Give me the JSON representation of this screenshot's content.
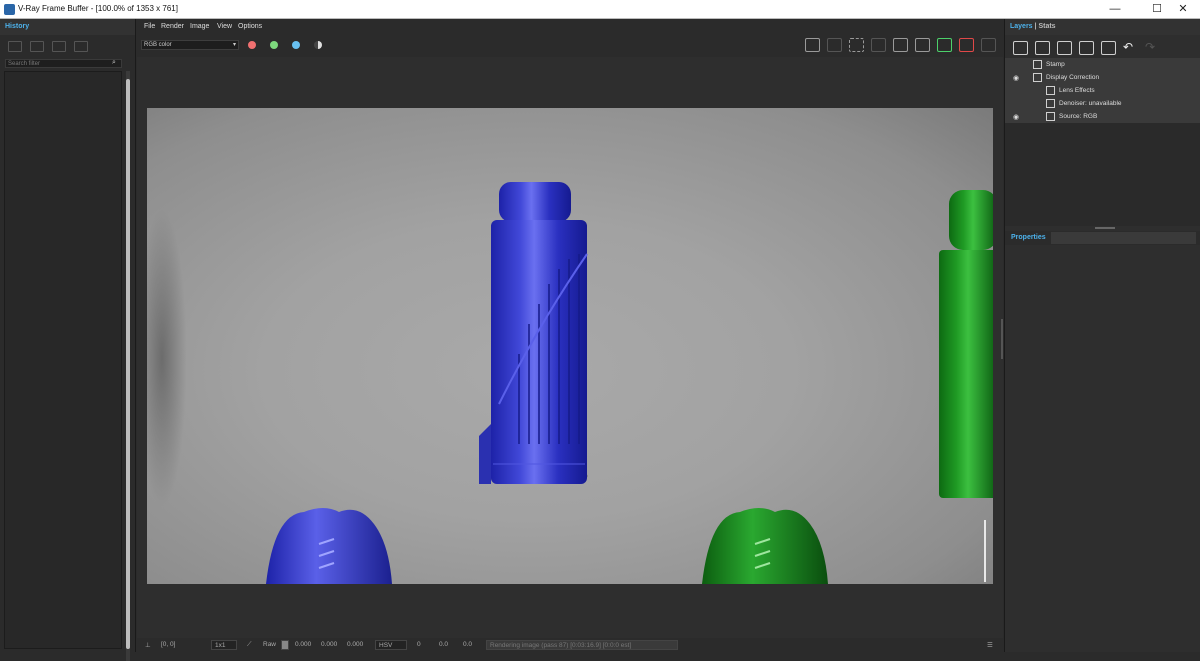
{
  "window": {
    "title": "V-Ray Frame Buffer - [100.0% of 1353 x 761]",
    "minimize": "—",
    "maximize": "☐",
    "close": "✕"
  },
  "history": {
    "tab": "History",
    "search_placeholder": "Search filter"
  },
  "menu": {
    "file": "File",
    "render": "Render",
    "image": "Image",
    "view": "View",
    "options": "Options"
  },
  "toolbar": {
    "channel": "RGB color",
    "channel_arrow": "▾",
    "colors": {
      "red": "#f07070",
      "green": "#7dd87d",
      "blue": "#68c0f0",
      "mono": "#e0e0e0"
    }
  },
  "status": {
    "coords": "[0, 0]",
    "zoom": "1x1",
    "raw": "Raw",
    "v1": "0.000",
    "v2": "0.000",
    "v3": "0.000",
    "color_mode": "HSV",
    "h": "0",
    "s": "0.0",
    "v": "0.0",
    "message": "Rendering image (pass 87) [0:03:16.9] [0:0:0 est]"
  },
  "right_panel": {
    "tab_layers": "Layers",
    "tab_sep": "|",
    "tab_stats": "Stats",
    "layers": [
      {
        "label": "Stamp"
      },
      {
        "label": "Display Correction"
      },
      {
        "label": "Lens Effects"
      },
      {
        "label": "Denoiser: unavailable"
      },
      {
        "label": "Source: RGB"
      }
    ],
    "properties": "Properties"
  }
}
